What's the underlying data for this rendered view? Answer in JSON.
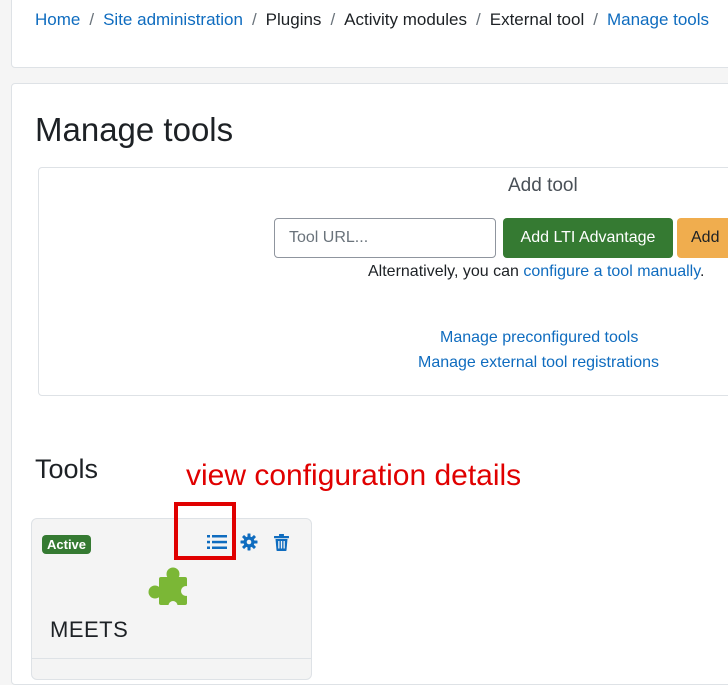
{
  "breadcrumb": {
    "items": [
      {
        "label": "Home",
        "link": true
      },
      {
        "label": "Site administration",
        "link": true
      },
      {
        "label": "Plugins",
        "link": false
      },
      {
        "label": "Activity modules",
        "link": false
      },
      {
        "label": "External tool",
        "link": false
      },
      {
        "label": "Manage tools",
        "link": true
      }
    ],
    "separator": "/"
  },
  "page": {
    "title": "Manage tools"
  },
  "add_tool": {
    "heading": "Add tool",
    "url_placeholder": "Tool URL...",
    "url_value": "",
    "lti_button": "Add LTI Advantage",
    "add_button": "Add",
    "alt_prefix": "Alternatively, you can ",
    "alt_link": "configure a tool manually",
    "alt_suffix": ".",
    "preconfigured_link": "Manage preconfigured tools",
    "registrations_link": "Manage external tool registrations"
  },
  "tools": {
    "heading": "Tools",
    "annotation": "view configuration details",
    "cards": [
      {
        "status": "Active",
        "name": "MEETS",
        "icons": [
          "list-icon",
          "gear-icon",
          "trash-icon",
          "puzzle-piece-icon"
        ]
      }
    ]
  },
  "colors": {
    "link": "#0f6cbf",
    "success": "#357a32",
    "warning": "#f0ad4e",
    "annotation": "#e00000",
    "puzzle": "#7bb736"
  }
}
